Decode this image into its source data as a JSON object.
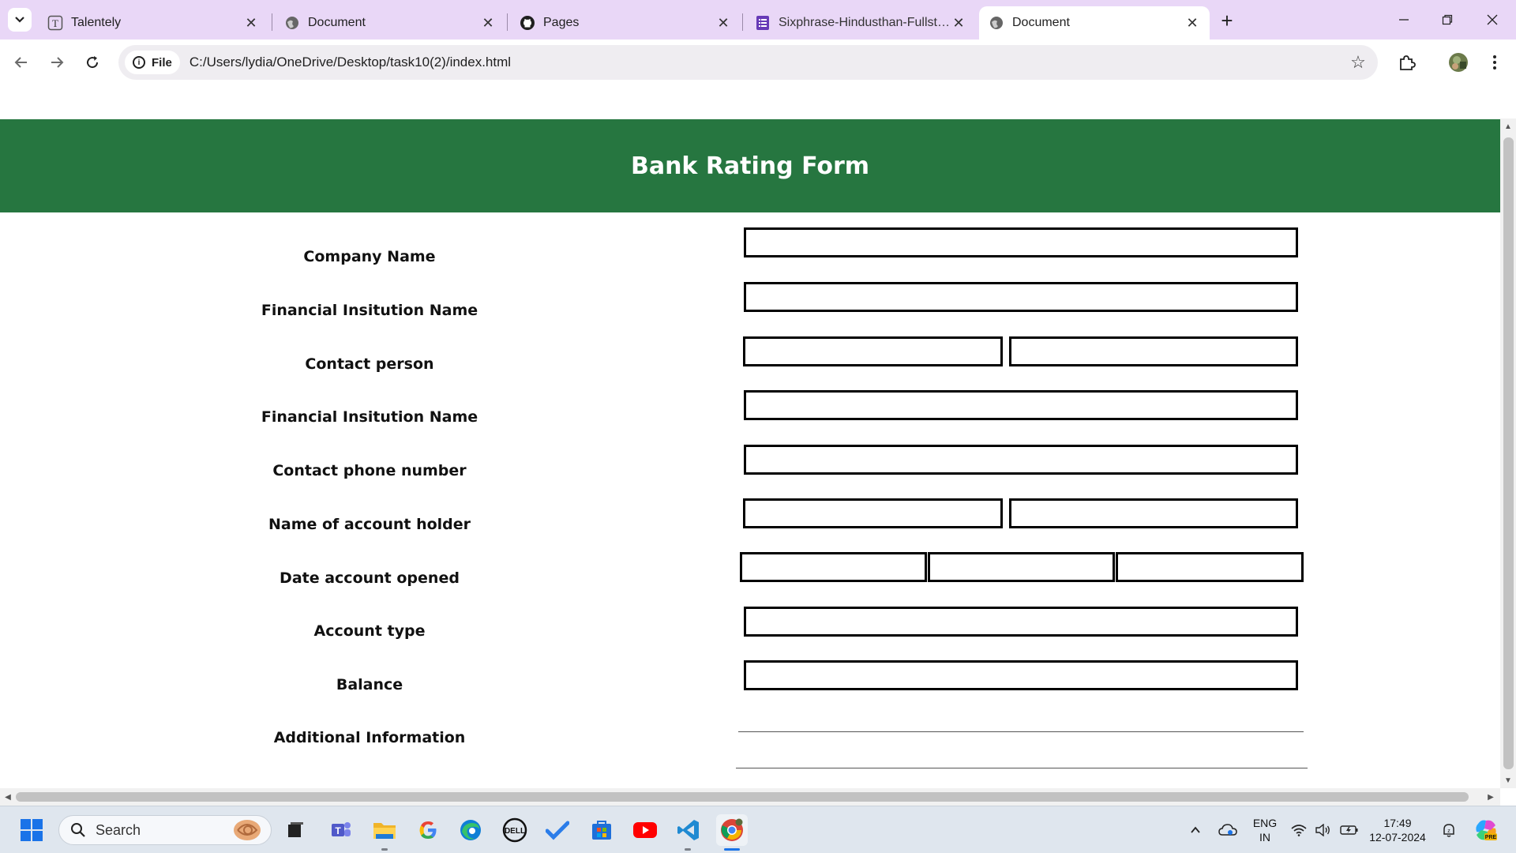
{
  "browser": {
    "tabs": [
      {
        "title": "Talentely",
        "favicon": "talentely-icon",
        "active": false
      },
      {
        "title": "Document",
        "favicon": "globe-icon",
        "active": false
      },
      {
        "title": "Pages",
        "favicon": "github-icon",
        "active": false
      },
      {
        "title": "Sixphrase-Hindusthan-Fullstack",
        "favicon": "forms-icon",
        "active": false
      },
      {
        "title": "Document",
        "favicon": "globe-icon",
        "active": true
      }
    ],
    "address": {
      "scheme_chip": "File",
      "url": "C:/Users/lydia/OneDrive/Desktop/task10(2)/index.html"
    }
  },
  "page": {
    "heading": "Bank Rating Form",
    "colors": {
      "banner": "#267640",
      "banner_text": "#ffffff"
    },
    "fields": [
      {
        "label": "Company Name",
        "inputs": 1
      },
      {
        "label": "Financial Insitution Name",
        "inputs": 1
      },
      {
        "label": "Contact person",
        "inputs": 2
      },
      {
        "label": "Financial Insitution Name",
        "inputs": 1
      },
      {
        "label": "Contact phone number",
        "inputs": 1
      },
      {
        "label": "Name of account holder",
        "inputs": 2
      },
      {
        "label": "Date account opened",
        "inputs": 3
      },
      {
        "label": "Account type",
        "inputs": 1
      },
      {
        "label": "Balance",
        "inputs": 1
      },
      {
        "label": "Additional Information",
        "inputs": 0
      }
    ]
  },
  "taskbar": {
    "search_placeholder": "Search",
    "apps": [
      "windows-start-icon",
      "task-view-icon",
      "teams-icon",
      "file-explorer-icon",
      "google-icon",
      "edge-icon",
      "dell-icon",
      "todo-icon",
      "store-icon",
      "youtube-icon",
      "vscode-icon",
      "chrome-icon"
    ],
    "language": {
      "line1": "ENG",
      "line2": "IN"
    },
    "clock": {
      "time": "17:49",
      "date": "12-07-2024"
    }
  }
}
